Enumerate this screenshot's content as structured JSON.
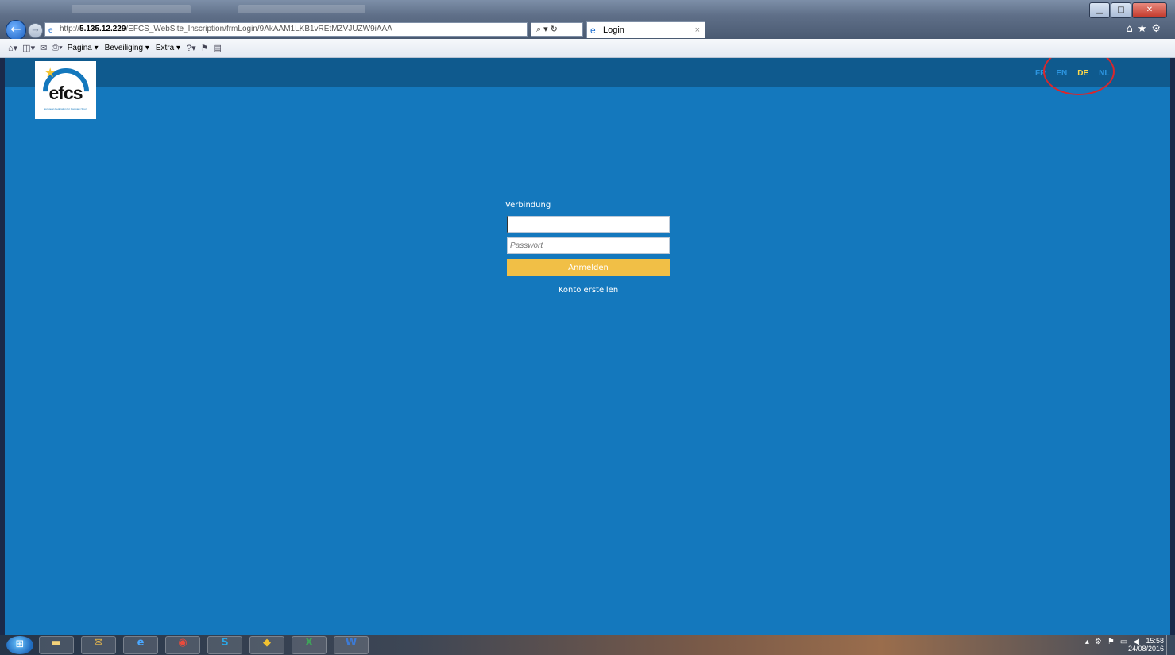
{
  "browser": {
    "url_prefix": "http://",
    "url_host": "5.135.12.229",
    "url_path": "/EFCS_WebSite_Inscription/frmLogin/9AkAAM1LKB1vREtMZVJUZW9iAAA",
    "tab_title": "Login",
    "tab_close": "×",
    "window_buttons": {
      "minimize": "▁",
      "maximize": "□",
      "close": "✕"
    },
    "right_icons": "⌂★⚙"
  },
  "command_bar": {
    "items": [
      "Pagina ▾",
      "Beveiliging ▾",
      "Extra ▾"
    ],
    "help": "?▾"
  },
  "site": {
    "logo_text": "efcs",
    "logo_tagline": "European Federation for Company Sport",
    "languages": [
      {
        "code": "FR",
        "active": false
      },
      {
        "code": "EN",
        "active": false
      },
      {
        "code": "DE",
        "active": true
      },
      {
        "code": "NL",
        "active": false
      }
    ]
  },
  "login": {
    "title": "Verbindung",
    "username_value": "",
    "password_placeholder": "Passwort",
    "submit_label": "Anmelden",
    "create_account_label": "Konto erstellen"
  },
  "taskbar": {
    "apps": [
      "explorer",
      "outlook",
      "ie",
      "chrome",
      "skype",
      "security",
      "excel",
      "word"
    ],
    "time": "15:58",
    "date": "24/08/2016"
  },
  "colors": {
    "page_background": "#1478bd",
    "header_band": "#0f5a8e",
    "login_button": "#f1bf46",
    "active_language": "#ffd84a",
    "inactive_language": "#2d95e0",
    "highlight_circle": "#d8272d"
  }
}
